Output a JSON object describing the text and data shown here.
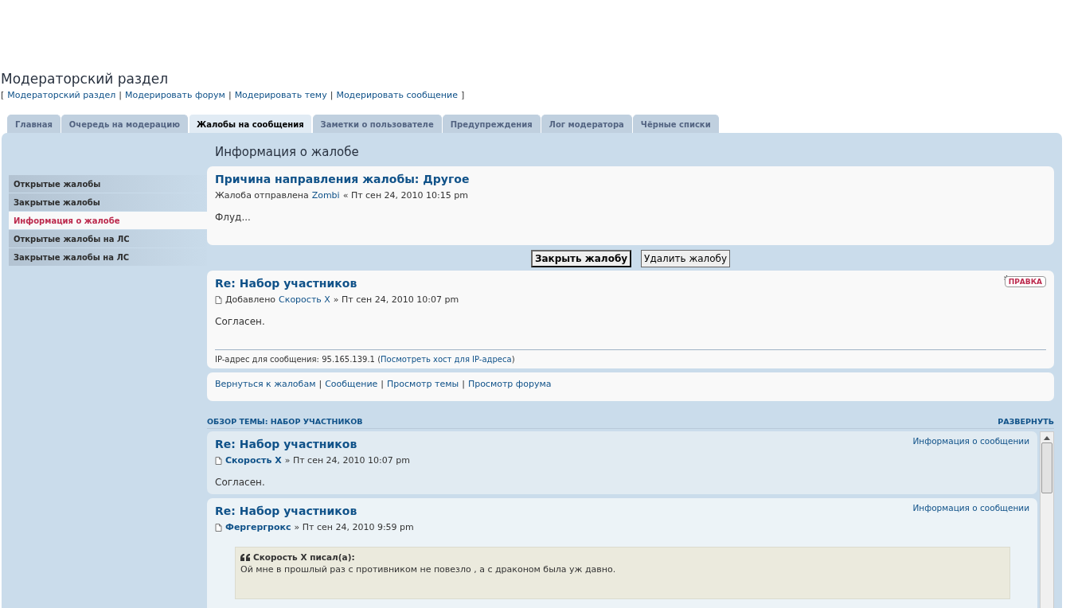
{
  "header": {
    "title": "Модераторский раздел",
    "links": [
      {
        "kind": "bracket",
        "text": "["
      },
      {
        "kind": "link",
        "text": "Модераторский раздел"
      },
      {
        "kind": "sep",
        "text": "|"
      },
      {
        "kind": "link",
        "text": "Модерировать форум"
      },
      {
        "kind": "sep",
        "text": "|"
      },
      {
        "kind": "link",
        "text": "Модерировать тему"
      },
      {
        "kind": "sep",
        "text": "|"
      },
      {
        "kind": "link",
        "text": "Модерировать сообщение"
      },
      {
        "kind": "bracket",
        "text": "]"
      }
    ]
  },
  "tabs": [
    {
      "label": "Главная",
      "selected": false
    },
    {
      "label": "Очередь на модерацию",
      "selected": false
    },
    {
      "label": "Жалобы на сообщения",
      "selected": true
    },
    {
      "label": "Заметки о пользователе",
      "selected": false
    },
    {
      "label": "Предупреждения",
      "selected": false
    },
    {
      "label": "Лог модератора",
      "selected": false
    },
    {
      "label": "Чёрные списки",
      "selected": false
    }
  ],
  "sidebar": {
    "items": [
      {
        "label": "Открытые жалобы",
        "selected": false
      },
      {
        "label": "Закрытые жалобы",
        "selected": false
      },
      {
        "label": "Информация о жалобе",
        "selected": true
      },
      {
        "label": "Открытые жалобы на ЛС",
        "selected": false
      },
      {
        "label": "Закрытые жалобы на ЛС",
        "selected": false
      }
    ]
  },
  "main": {
    "heading": "Информация о жалобе",
    "report": {
      "title": "Причина направления жалобы: Другое",
      "meta_prefix": "Жалоба отправлена",
      "author": "Zombi",
      "meta_suffix": "« Пт сен 24, 2010 10:15 pm",
      "body": "Флуд..."
    },
    "buttons": [
      {
        "label": "Закрыть жалобу",
        "primary": true
      },
      {
        "label": "Удалить жалобу",
        "primary": false
      }
    ],
    "post": {
      "title": "Re: Набор участников",
      "edit_label": "ПРАВКА",
      "meta_prefix": "Добавлено",
      "author": "Скорость X",
      "meta_suffix": "» Пт сен 24, 2010 10:07 pm",
      "body": "Согласен.",
      "ip_text": "IP-адрес для сообщения: 95.165.139.1 (",
      "ip_link": "Посмотреть хост для IP-адреса",
      "ip_close": ")"
    },
    "nav_links": [
      {
        "kind": "link",
        "text": "Вернуться к жалобам"
      },
      {
        "kind": "sep",
        "text": "|"
      },
      {
        "kind": "link",
        "text": "Сообщение"
      },
      {
        "kind": "sep",
        "text": "|"
      },
      {
        "kind": "link",
        "text": "Просмотр темы"
      },
      {
        "kind": "sep",
        "text": "|"
      },
      {
        "kind": "link",
        "text": "Просмотр форума"
      }
    ],
    "review": {
      "title": "ОБЗОР ТЕМЫ: НАБОР УЧАСТНИКОВ",
      "expand": "РАЗВЕРНУТЬ",
      "posts": [
        {
          "title": "Re: Набор участников",
          "info": "Информация о сообщении",
          "author": "Скорость X",
          "date": "» Пт сен 24, 2010 10:07 pm",
          "body": "Согласен."
        },
        {
          "title": "Re: Набор участников",
          "info": "Информация о сообщении",
          "author": "Фергергрокс",
          "date": "» Пт сен 24, 2010 9:59 pm",
          "quote": {
            "author": "Скорость X писал(а):",
            "text": "Ой мне в прошлый раз с противником не повезло , а с драконом была уж давно."
          }
        }
      ]
    }
  }
}
